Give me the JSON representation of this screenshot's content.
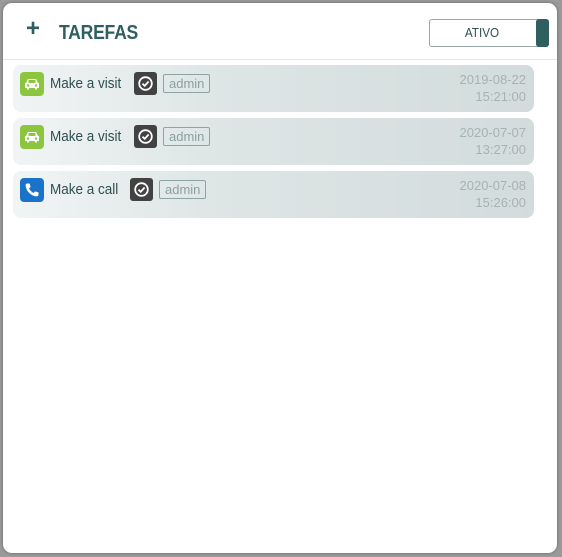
{
  "header": {
    "add_label": "+",
    "title": "TAREFAS",
    "toggle_label": "ATIVO"
  },
  "tasks": [
    {
      "title": "Make a visit",
      "type_icon": "car-icon",
      "user": "admin",
      "date": "2019-08-22",
      "time": "15:21:00"
    },
    {
      "title": "Make a visit",
      "type_icon": "car-icon",
      "user": "admin",
      "date": "2020-07-07",
      "time": "13:27:00"
    },
    {
      "title": "Make a call",
      "type_icon": "phone-icon",
      "user": "admin",
      "date": "2020-07-08",
      "time": "15:26:00"
    }
  ],
  "colors": {
    "accent": "#2f5f62",
    "visit_icon_bg": "#8cc63f",
    "call_icon_bg": "#1a73c8",
    "check_bg": "#424242"
  }
}
